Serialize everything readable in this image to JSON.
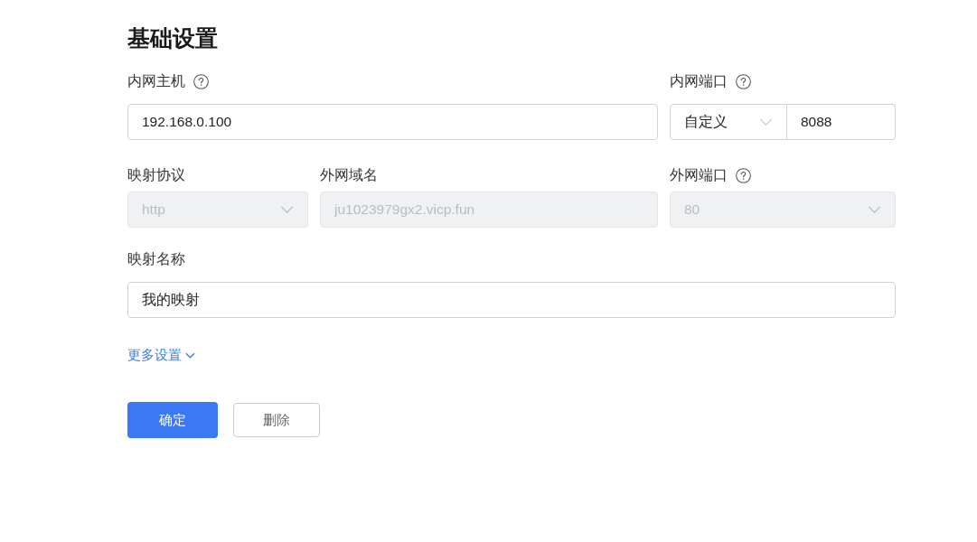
{
  "title": "基础设置",
  "rows": [
    {
      "fields": [
        {
          "kind": "text",
          "label": "内网主机",
          "help": true,
          "value": "192.168.0.100",
          "disabled": false
        },
        {
          "kind": "combo",
          "label": "内网端口",
          "help": true,
          "option": "自定义",
          "value": "8088",
          "disabled": false
        }
      ]
    },
    {
      "fields": [
        {
          "kind": "select",
          "label": "映射协议",
          "help": false,
          "value": "http",
          "disabled": true
        },
        {
          "kind": "text",
          "label": "外网域名",
          "help": false,
          "value": "ju1023979gx2.vicp.fun",
          "disabled": true
        },
        {
          "kind": "select",
          "label": "外网端口",
          "help": true,
          "value": "80",
          "disabled": true
        }
      ]
    },
    {
      "fields": [
        {
          "kind": "text",
          "label": "映射名称",
          "help": false,
          "value": "我的映射",
          "disabled": false
        }
      ]
    }
  ],
  "more_settings": {
    "label": "更多设置",
    "expanded": false
  },
  "buttons": [
    {
      "label": "确定",
      "kind": "primary"
    },
    {
      "label": "删除",
      "kind": "secondary"
    }
  ]
}
